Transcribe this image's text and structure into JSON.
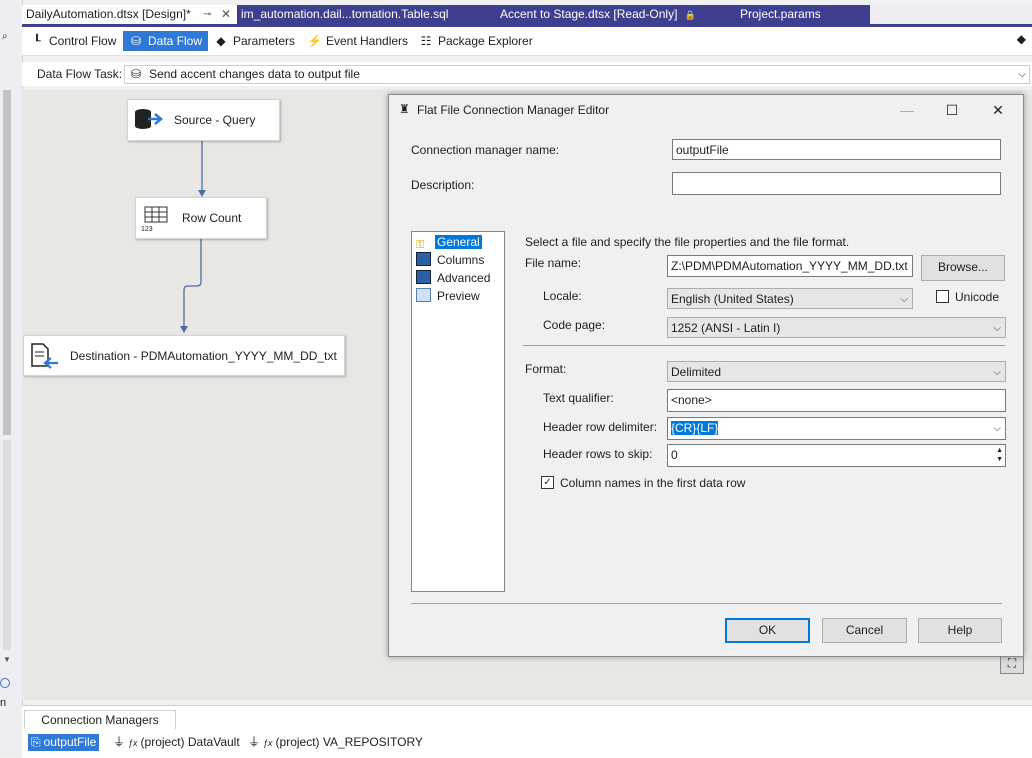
{
  "tabs": [
    {
      "label": "DailyAutomation.dtsx [Design]*",
      "pin": "⊸",
      "close": "✕"
    },
    {
      "label": "im_automation.dail...tomation.Table.sql"
    },
    {
      "label": "Accent to Stage.dtsx [Read-Only]"
    },
    {
      "label": "Project.params"
    }
  ],
  "designer_tabs": [
    {
      "label": "Control Flow"
    },
    {
      "label": "Data Flow"
    },
    {
      "label": "Parameters"
    },
    {
      "label": "Event Handlers"
    },
    {
      "label": "Package Explorer"
    }
  ],
  "task": {
    "label": "Data Flow Task:",
    "value": "Send accent changes data to output file"
  },
  "canvas": {
    "nodes": [
      {
        "label": "Source - Query",
        "icon": "database-icon"
      },
      {
        "label": "Row Count",
        "icon": "grid-counter-icon",
        "sub": "123"
      },
      {
        "label": "Destination - PDMAutomation_YYYY_MM_DD_txt",
        "icon": "file-destination-icon"
      }
    ]
  },
  "dialog": {
    "title": "Flat File Connection Manager Editor",
    "conn_name_label": "Connection manager name:",
    "conn_name_value": "outputFile",
    "description_label": "Description:",
    "description_value": "",
    "nav": [
      "General",
      "Columns",
      "Advanced",
      "Preview"
    ],
    "instruction": "Select a file and specify the file properties and the file format.",
    "file_name_label": "File name:",
    "file_name_value": "Z:\\PDM\\PDMAutomation_YYYY_MM_DD.txt",
    "browse_label": "Browse...",
    "locale_label": "Locale:",
    "locale_value": "English (United States)",
    "unicode_label": "Unicode",
    "codepage_label": "Code page:",
    "codepage_value": "1252  (ANSI - Latin I)",
    "format_label": "Format:",
    "format_value": "Delimited",
    "text_qualifier_label": "Text qualifier:",
    "text_qualifier_value": "<none>",
    "header_delim_label": "Header row delimiter:",
    "header_delim_value": "{CR}{LF}",
    "header_skip_label": "Header rows to skip:",
    "header_skip_value": "0",
    "col_names_label": "Column names in the first data row",
    "ok_label": "OK",
    "cancel_label": "Cancel",
    "help_label": "Help"
  },
  "connection_managers": {
    "tab_label": "Connection Managers",
    "items": [
      "outputFile",
      "(project) DataVault",
      "(project) VA_REPOSITORY"
    ]
  },
  "colors": {
    "accent": "#2e7ad6",
    "tab_inactive": "#3f3f8f",
    "selection": "#0078d7",
    "canvas": "#e9e7e3"
  }
}
